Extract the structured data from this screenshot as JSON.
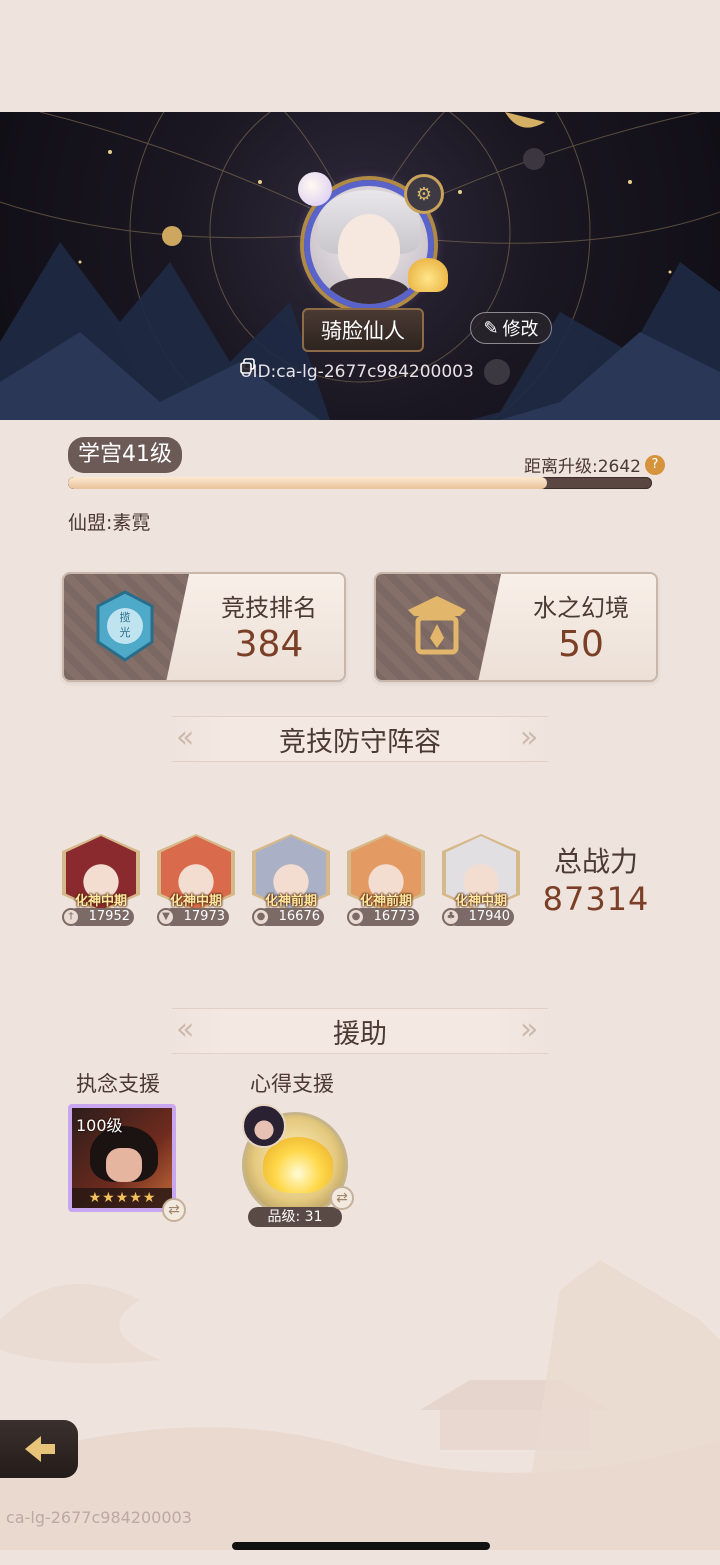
{
  "profile": {
    "nickname": "骑脸仙人",
    "edit_label": "修改",
    "uid": "UID:ca-lg-2677c984200003"
  },
  "level": {
    "badge": "学宫41级",
    "to_next": "距离升级:2642",
    "progress": 0.82
  },
  "alliance": "仙盟:素霓",
  "cards": {
    "arena": {
      "title": "竞技排名",
      "value": "384",
      "emblem_text": "揽光"
    },
    "realm": {
      "title": "水之幻境",
      "value": "50"
    }
  },
  "sections": {
    "defense": "竞技防守阵容",
    "support": "援助"
  },
  "heroes": [
    {
      "stage": "化神中期",
      "power": "17952",
      "element_icon": "sword-icon",
      "accent": "#8a2a2e"
    },
    {
      "stage": "化神中期",
      "power": "17973",
      "element_icon": "bookmark-icon",
      "accent": "#d96b4c"
    },
    {
      "stage": "化神前期",
      "power": "16676",
      "element_icon": "droplet-icon",
      "accent": "#aab1c6"
    },
    {
      "stage": "化神前期",
      "power": "16773",
      "element_icon": "droplet-icon",
      "accent": "#e49b63"
    },
    {
      "stage": "化神中期",
      "power": "17940",
      "element_icon": "leaf-icon",
      "accent": "#e2dfe3"
    }
  ],
  "total_power": {
    "label": "总战力",
    "value": "87314"
  },
  "support": {
    "obsession": {
      "label": "执念支援",
      "level": "100级",
      "stars": 5
    },
    "insight": {
      "label": "心得支援",
      "grade": "品级: 31"
    }
  },
  "watermark": "ca-lg-2677c984200003",
  "colors": {
    "accent_brown": "#7a3f26",
    "badge_bg": "#6b5a56",
    "banner_bg": "#1a1722"
  }
}
